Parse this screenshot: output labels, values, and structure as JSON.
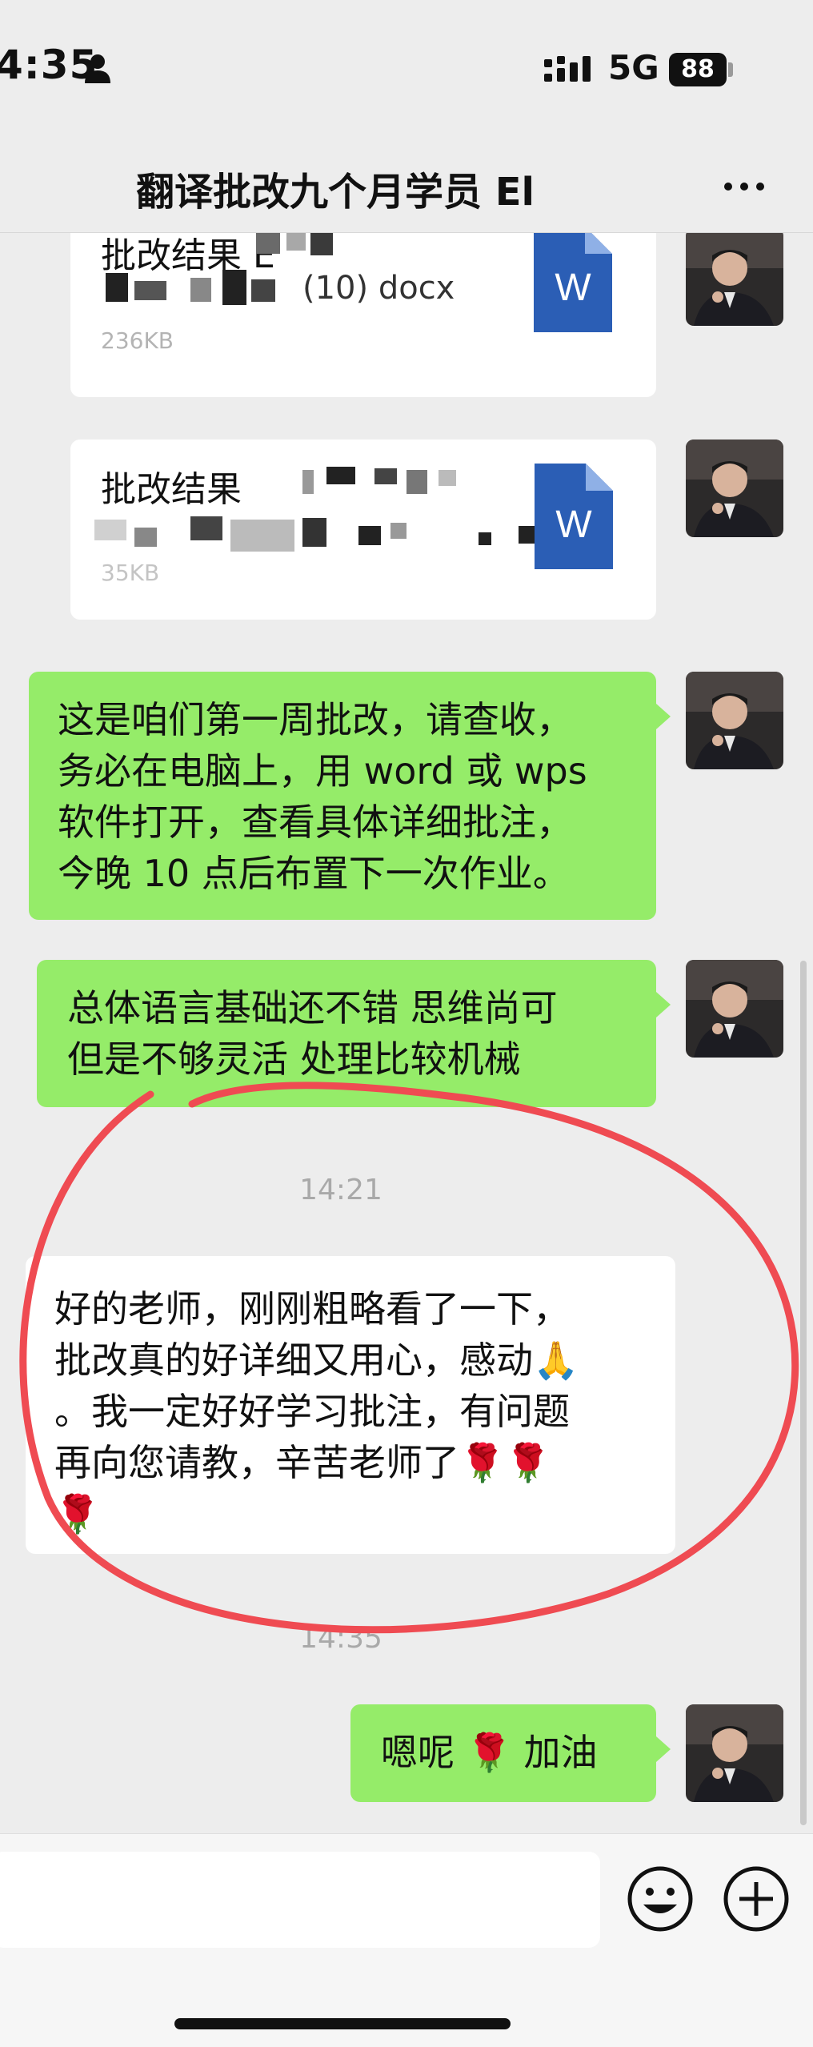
{
  "status": {
    "time": "4:35",
    "network": "5G",
    "battery": "88"
  },
  "header": {
    "title": "翻译批改九个月学员 El"
  },
  "messages": {
    "file1": {
      "name_visible": "批改结果 E",
      "size": "236KB",
      "partial_line": "(10) docx"
    },
    "file2": {
      "name_visible": "批改结果",
      "size": "35KB"
    },
    "msg1": {
      "lines": [
        "这是咱们第一周批改，请查收，",
        "务必在电脑上，用 word 或 wps",
        "软件打开，查看具体详细批注，",
        "今晚 10 点后布置下一次作业。"
      ]
    },
    "msg2": {
      "lines": [
        "总体语言基础还不错 思维尚可",
        "但是不够灵活 处理比较机械"
      ]
    },
    "time1": "14:21",
    "msg3": {
      "lines": [
        "好的老师，刚刚粗略看了一下，",
        "批改真的好详细又用心，感动🙏",
        "。我一定好好学习批注，有问题",
        "再向您请教，辛苦老师了🌹🌹",
        "🌹"
      ]
    },
    "time2": "14:35",
    "msg4": {
      "text": "嗯呢 🌹 加油"
    }
  },
  "icons": {
    "word_file": "word-document-icon",
    "more": "more-dots-icon",
    "emoji": "emoji-face-icon",
    "plus": "plus-circle-icon",
    "person": "person-icon",
    "signal": "signal-icon"
  },
  "colors": {
    "sent_bubble": "#95ec69",
    "received_bubble": "#ffffff",
    "background": "#ededed",
    "word_blue": "#2b5eb5",
    "annotation_red": "#ef4b52"
  }
}
